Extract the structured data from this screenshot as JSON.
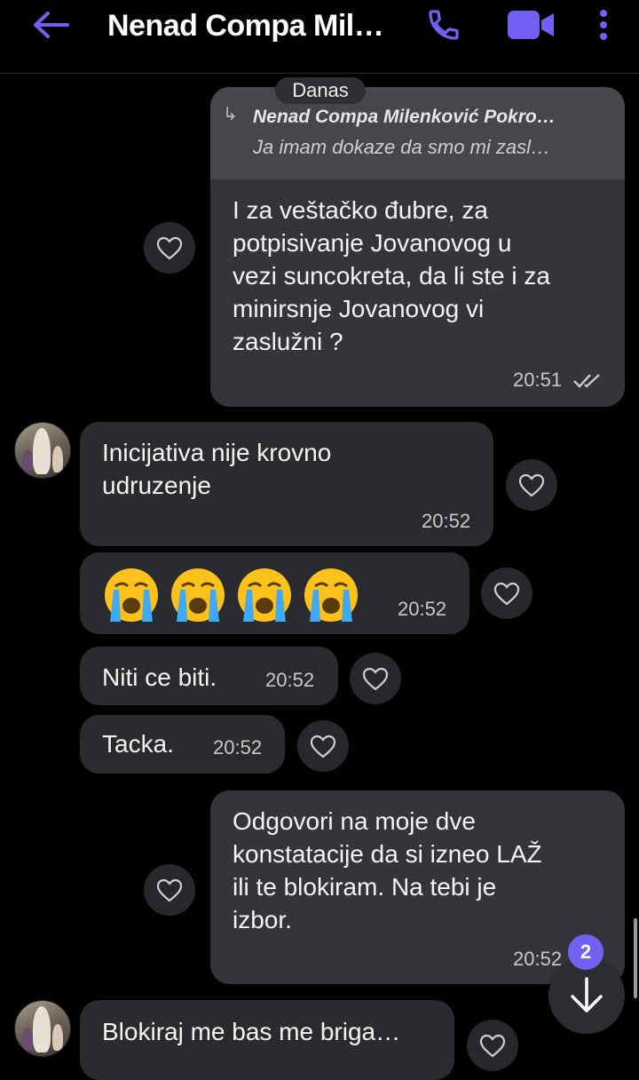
{
  "header": {
    "title": "Nenad Compa Mil…",
    "back_icon": "arrow-left-icon",
    "call_icon": "phone-icon",
    "video_icon": "video-camera-icon",
    "menu_icon": "more-vertical-icon",
    "accent": "#7360f2"
  },
  "date_separator": "Danas",
  "messages": [
    {
      "direction": "outgoing",
      "quote": {
        "name": "Nenad Compa Milenković Pokro…",
        "text": "Ja imam dokaze da smo mi zasl…"
      },
      "lines": [
        "I za veštačko đubre, za",
        "potpisivanje Jovanovog u",
        "vezi suncokreta, da li ste i za",
        "minirsnje Jovanovog vi",
        "zaslužni ?"
      ],
      "time": "20:51",
      "status": "read"
    },
    {
      "direction": "incoming",
      "lines": [
        "Inicijativa nije krovno",
        "udruzenje"
      ],
      "time": "20:52"
    },
    {
      "direction": "incoming",
      "emoji": "😭😭😭😭",
      "time": "20:52"
    },
    {
      "direction": "incoming",
      "lines": [
        "Niti ce biti."
      ],
      "time": "20:52"
    },
    {
      "direction": "incoming",
      "lines": [
        "Tacka."
      ],
      "time": "20:52"
    },
    {
      "direction": "outgoing",
      "lines": [
        "Odgovori na moje dve",
        "konstatacije da si izneo LAŽ",
        "ili te blokiram. Na tebi je",
        "izbor."
      ],
      "time": "20:52"
    },
    {
      "direction": "incoming",
      "lines": [
        "Blokiraj me bas me briga…"
      ]
    }
  ],
  "unread_badge": "2",
  "scroll_down_icon": "arrow-down-icon",
  "like_icon": "heart-icon"
}
